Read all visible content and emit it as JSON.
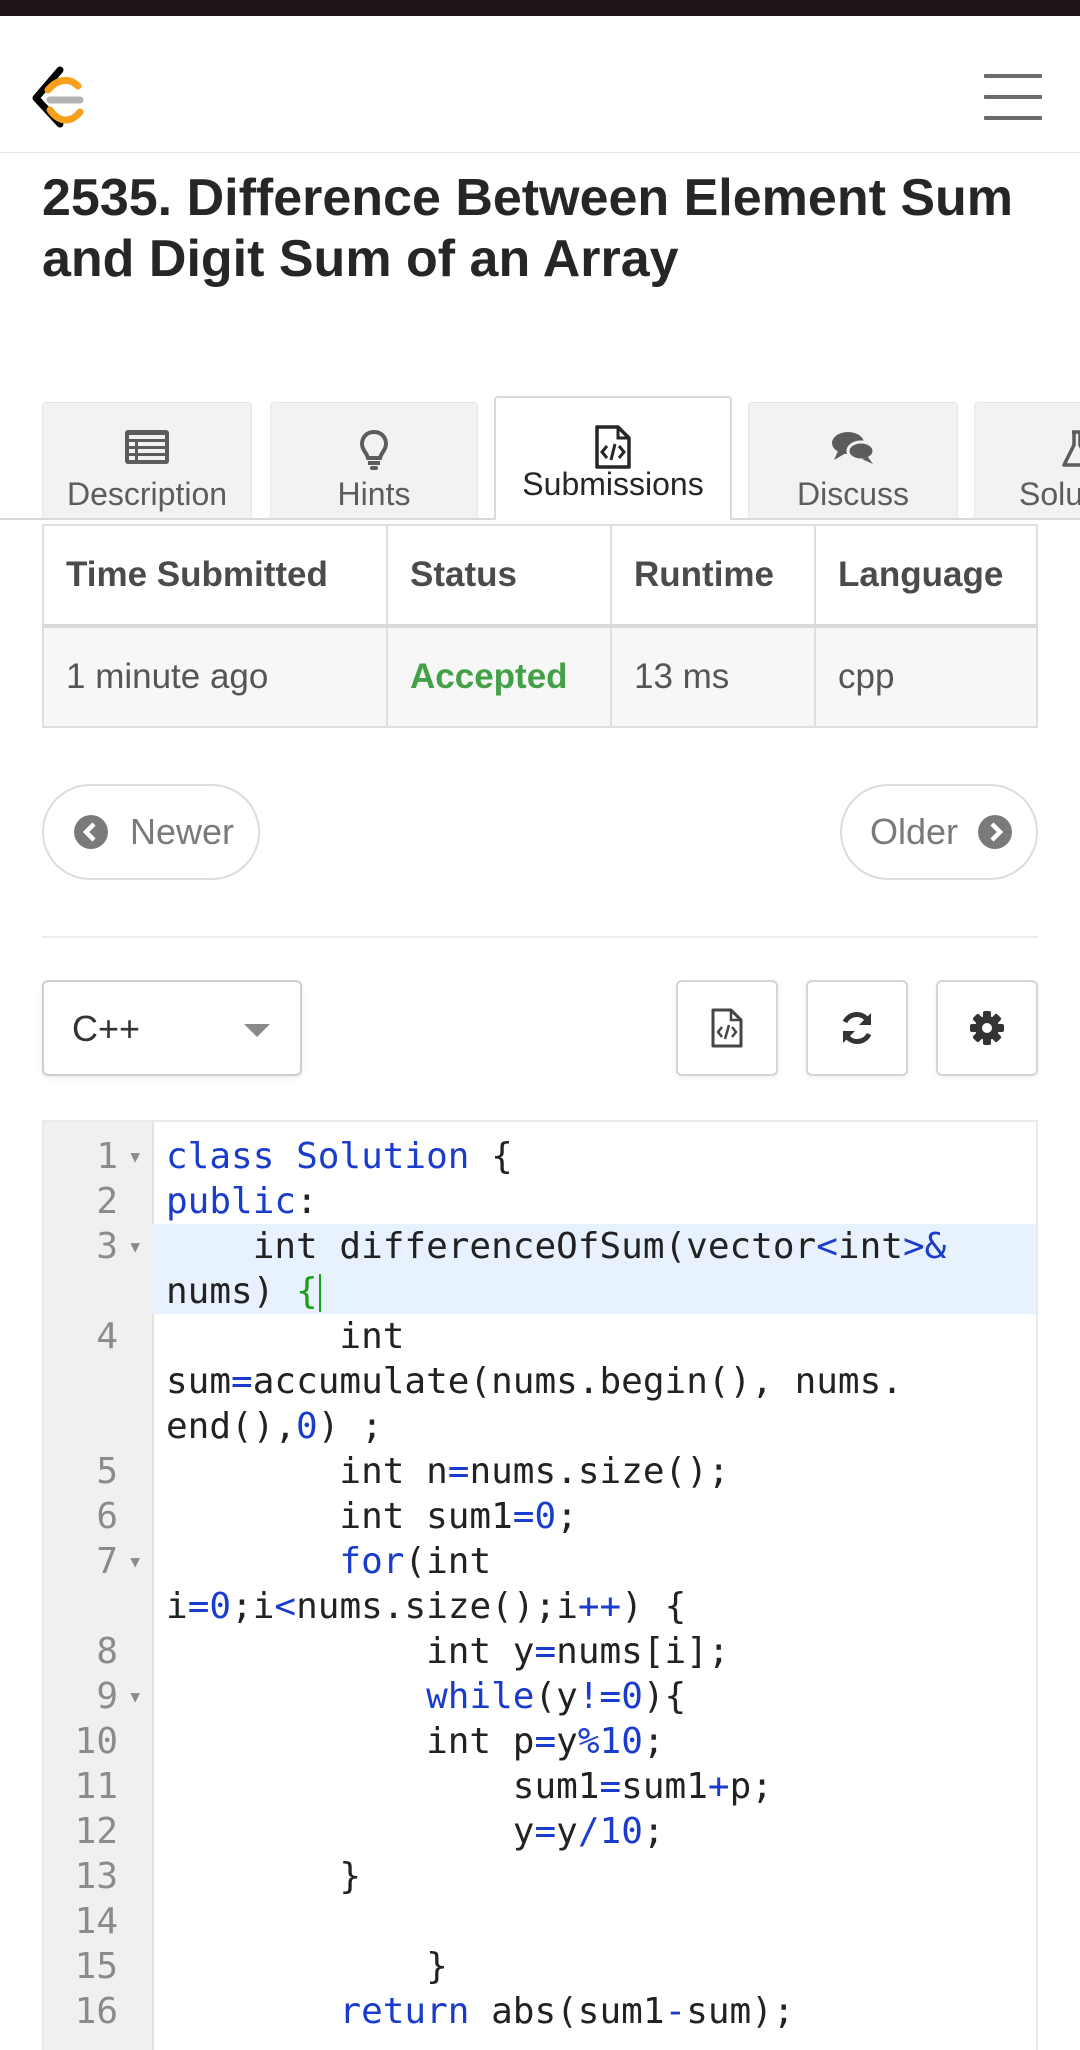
{
  "problem": {
    "title": "2535. Difference Between Element Sum and Digit Sum of an Array"
  },
  "tabs": [
    {
      "label": "Description",
      "icon": "description-icon"
    },
    {
      "label": "Hints",
      "icon": "lightbulb-icon"
    },
    {
      "label": "Submissions",
      "icon": "code-file-icon",
      "active": true
    },
    {
      "label": "Discuss",
      "icon": "chat-bubbles-icon"
    },
    {
      "label": "Solu",
      "icon": "flask-icon"
    }
  ],
  "submissions": {
    "headers": [
      "Time Submitted",
      "Status",
      "Runtime",
      "Language"
    ],
    "rows": [
      {
        "time": "1 minute ago",
        "status": "Accepted",
        "runtime": "13 ms",
        "language": "cpp"
      }
    ]
  },
  "pager": {
    "newer": "Newer",
    "older": "Older"
  },
  "editor": {
    "language": "C++",
    "lines": [
      {
        "n": "1",
        "fold": true
      },
      {
        "n": "2"
      },
      {
        "n": "3",
        "fold": true,
        "highlighted": true
      },
      {
        "n": "4"
      },
      {
        "n": "5"
      },
      {
        "n": "6"
      },
      {
        "n": "7",
        "fold": true
      },
      {
        "n": "8"
      },
      {
        "n": "9",
        "fold": true
      },
      {
        "n": "10"
      },
      {
        "n": "11"
      },
      {
        "n": "12"
      },
      {
        "n": "13"
      },
      {
        "n": "14"
      },
      {
        "n": "15"
      },
      {
        "n": "16"
      }
    ]
  },
  "colors": {
    "accepted": "#43a047",
    "keyword": "#1a3ccc",
    "bracket_match": "#18a018",
    "logo_orange": "#f89f1b"
  }
}
